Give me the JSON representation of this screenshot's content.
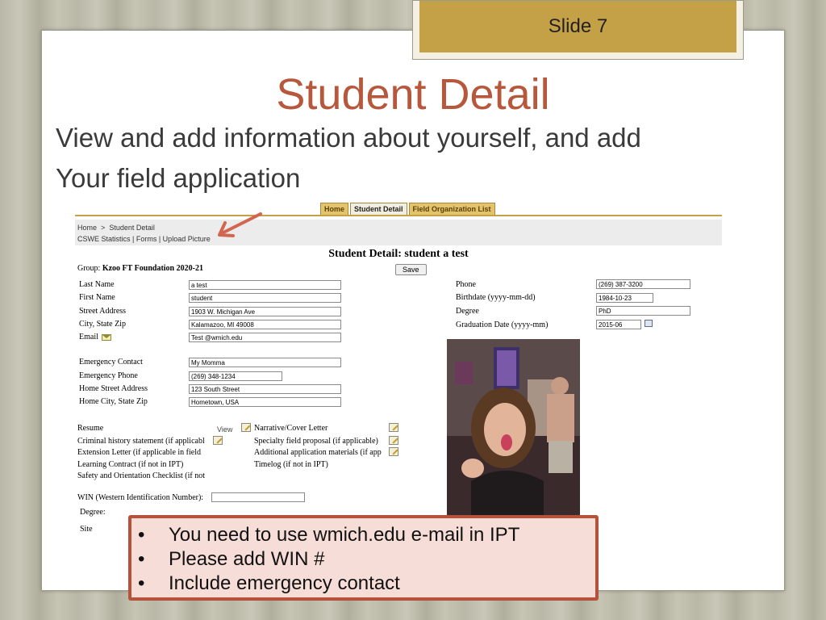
{
  "slide": {
    "number_label": "Slide 7",
    "title": "Student Detail",
    "body_lines": [
      "View and add information about yourself, and add",
      "Your field application"
    ]
  },
  "nav": {
    "tabs": [
      "Home",
      "Student Detail",
      "Field Organization List"
    ],
    "active": "Student Detail"
  },
  "breadcrumb": {
    "home": "Home",
    "sep": ">",
    "current": "Student Detail",
    "links": "CSWE Statistics | Forms | Upload Picture"
  },
  "form": {
    "title": "Student Detail: student a test",
    "group_label": "Group:",
    "group_value": "Kzoo FT Foundation 2020-21",
    "save_label": "Save",
    "last_name_label": "Last Name",
    "last_name": "a test",
    "first_name_label": "First Name",
    "first_name": "student",
    "street_label": "Street Address",
    "street": "1903 W. Michigan Ave",
    "city_label": "City, State Zip",
    "city": "Kalamazoo, MI 49008",
    "email_label": "Email",
    "email": "Test @wmich.edu",
    "emergency_contact_label": "Emergency Contact",
    "emergency_contact": "My Momma",
    "emergency_phone_label": "Emergency Phone",
    "emergency_phone": "(269) 348-1234",
    "home_street_label": "Home Street Address",
    "home_street": "123 South Street",
    "home_city_label": "Home City, State Zip",
    "home_city": "Hometown, USA",
    "phone_label": "Phone",
    "phone": "(269) 387-3200",
    "birthdate_label": "Birthdate (yyyy-mm-dd)",
    "birthdate": "1984-10-23",
    "degree_label": "Degree",
    "degree": "PhD",
    "grad_label": "Graduation Date (yyyy-mm)",
    "grad": "2015-06",
    "docs_left": [
      "Resume",
      "Criminal history statement (if applicabl",
      "Extension Letter (if applicable in field",
      "Learning Contract (if not in IPT)",
      "Safety and Orientation Checklist (if not"
    ],
    "view_label": "View",
    "docs_right": [
      "Narrative/Cover Letter",
      "Specialty field proposal (if applicable)",
      "Additional application materials (if app",
      "Timelog (if not in IPT)"
    ],
    "win_label": "WIN (Western Identification Number):",
    "win": "",
    "degree2_label": "Degree:",
    "site_label": "Site"
  },
  "callout": {
    "items": [
      "You need to use wmich.edu e-mail in IPT",
      "Please add WIN #",
      "Include emergency contact"
    ],
    "bullet": "•"
  },
  "colors": {
    "title": "#b7583d",
    "tab_gold": "#c4a047",
    "callout_border": "#b5533a",
    "callout_bg": "#f7ddd7"
  }
}
